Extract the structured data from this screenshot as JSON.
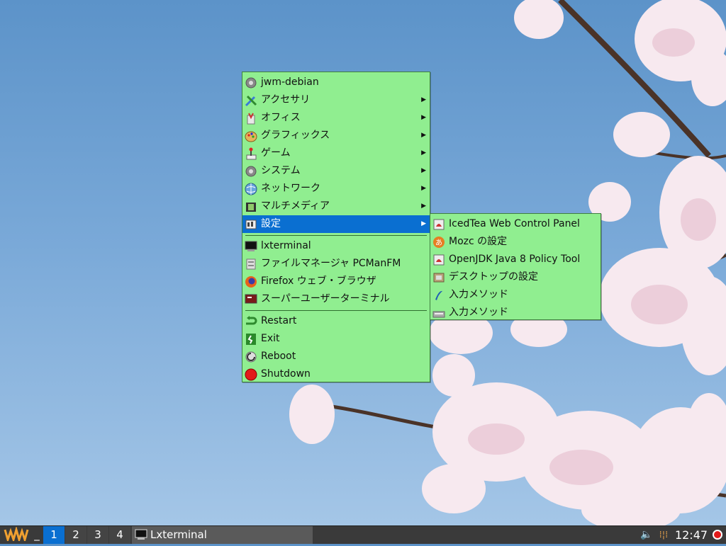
{
  "main_menu": {
    "items": [
      {
        "label": "jwm-debian",
        "icon": "gear-icon",
        "submenu": false
      },
      {
        "label": "アクセサリ",
        "icon": "accessories-icon",
        "submenu": true
      },
      {
        "label": "オフィス",
        "icon": "office-icon",
        "submenu": true
      },
      {
        "label": "グラフィックス",
        "icon": "graphics-palette-icon",
        "submenu": true
      },
      {
        "label": "ゲーム",
        "icon": "game-joystick-icon",
        "submenu": true
      },
      {
        "label": "システム",
        "icon": "system-gear-icon",
        "submenu": true
      },
      {
        "label": "ネットワーク",
        "icon": "network-globe-icon",
        "submenu": true
      },
      {
        "label": "マルチメディア",
        "icon": "multimedia-film-icon",
        "submenu": true
      },
      {
        "label": "設定",
        "icon": "settings-icon",
        "submenu": true,
        "active": true
      },
      {
        "label": "lxterminal",
        "icon": "terminal-icon",
        "submenu": false
      },
      {
        "label": "ファイルマネージャ PCManFM",
        "icon": "file-manager-icon",
        "submenu": false
      },
      {
        "label": "Firefox ウェブ・ブラウザ",
        "icon": "firefox-icon",
        "submenu": false
      },
      {
        "label": "スーパーユーザーターミナル",
        "icon": "root-terminal-icon",
        "submenu": false
      },
      {
        "label": "Restart",
        "icon": "restart-arrow-icon",
        "submenu": false
      },
      {
        "label": "Exit",
        "icon": "exit-door-icon",
        "submenu": false
      },
      {
        "label": "Reboot",
        "icon": "reboot-icon",
        "submenu": false
      },
      {
        "label": "Shutdown",
        "icon": "shutdown-red-icon",
        "submenu": false
      }
    ]
  },
  "settings_submenu": {
    "items": [
      {
        "label": "IcedTea Web Control Panel",
        "icon": "java-icedtea-icon"
      },
      {
        "label": "Mozc の設定",
        "icon": "mozc-icon"
      },
      {
        "label": "OpenJDK Java 8 Policy Tool",
        "icon": "java-policy-icon"
      },
      {
        "label": "デスクトップの設定",
        "icon": "desktop-settings-icon"
      },
      {
        "label": "入力メソッド",
        "icon": "input-method-icon"
      },
      {
        "label": "入力メソッド",
        "icon": "keyboard-input-icon"
      }
    ]
  },
  "taskbar": {
    "logo": "JWM",
    "minimize": "_",
    "workspaces": [
      "1",
      "2",
      "3",
      "4"
    ],
    "current_workspace": "1",
    "task_label": "Lxterminal",
    "clock": "12:47",
    "tray_icons": [
      "volume-icon",
      "network-icon",
      "shutdown-icon"
    ]
  },
  "colors": {
    "menu_bg": "#90ee90",
    "menu_active": "#0a6fd1",
    "taskbar_bg": "#3a3a3a"
  }
}
